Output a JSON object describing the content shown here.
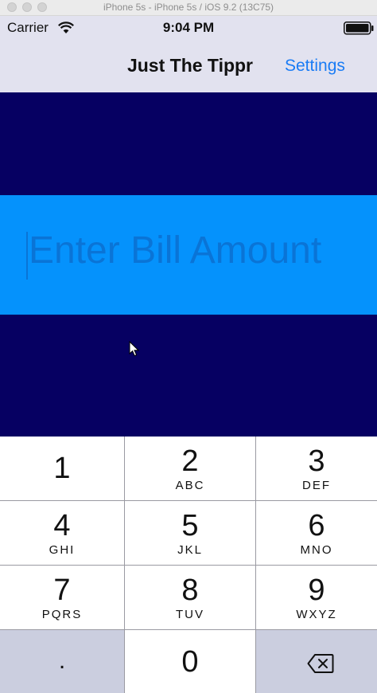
{
  "window": {
    "title": "iPhone 5s - iPhone 5s / iOS 9.2 (13C75)"
  },
  "status_bar": {
    "carrier": "Carrier",
    "time": "9:04 PM",
    "wifi_icon": "wifi-icon",
    "battery_icon": "battery-icon"
  },
  "nav": {
    "title": "Just The Tippr",
    "settings_label": "Settings"
  },
  "bill": {
    "placeholder": "Enter Bill Amount"
  },
  "colors": {
    "dark_band": "#060062",
    "bill_panel": "#0592fc",
    "accent": "#1a7cf5"
  },
  "keypad": {
    "keys": [
      {
        "num": "1",
        "letters": ""
      },
      {
        "num": "2",
        "letters": "ABC"
      },
      {
        "num": "3",
        "letters": "DEF"
      },
      {
        "num": "4",
        "letters": "GHI"
      },
      {
        "num": "5",
        "letters": "JKL"
      },
      {
        "num": "6",
        "letters": "MNO"
      },
      {
        "num": "7",
        "letters": "PQRS"
      },
      {
        "num": "8",
        "letters": "TUV"
      },
      {
        "num": "9",
        "letters": "WXYZ"
      },
      {
        "num": ".",
        "letters": ""
      },
      {
        "num": "0",
        "letters": ""
      },
      {
        "num": "",
        "letters": "",
        "icon": "backspace-icon"
      }
    ]
  }
}
